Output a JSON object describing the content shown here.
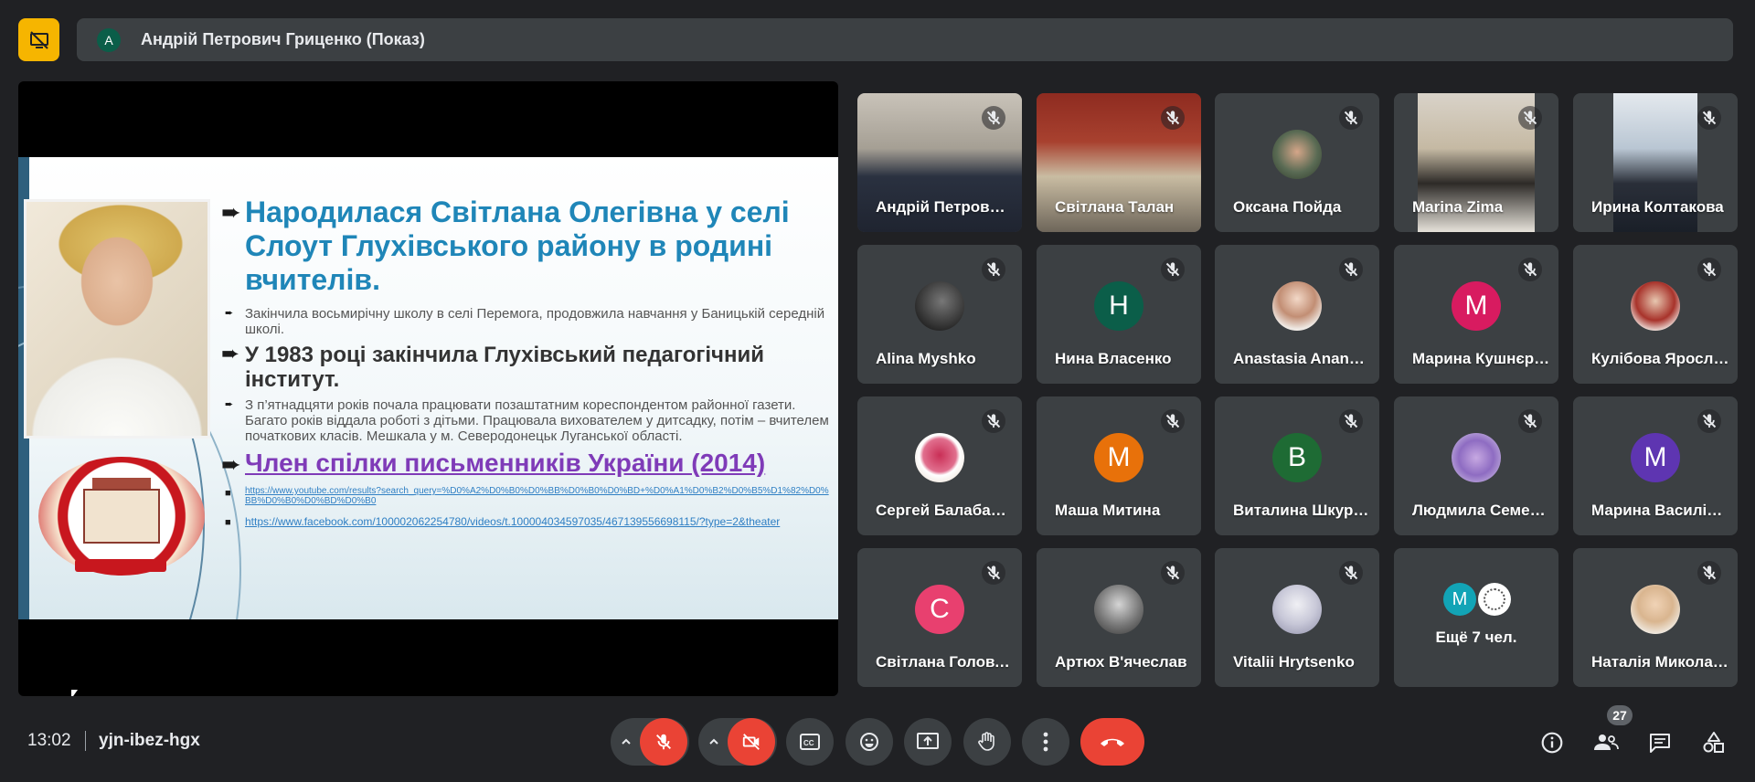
{
  "presenter_bar": {
    "avatar_letter": "A",
    "name": "Андрій Петрович Гриценко (Показ)"
  },
  "slide": {
    "heading": "Народилася Світлана Олегівна у селі Слоут Глухівського району в родині  вчителів.",
    "line1": "Закінчила восьмирічну школу в селі Перемога, продовжила навчання у Баницькій середній школі.",
    "line2": "У 1983 році закінчила Глухівський педагогічний інститут.",
    "line3": "З п’ятнадцяти років почала працювати позаштатним кореспондентом районної газети. Багато років віддала роботі з дітьми. Працювала вихователем у дитсадку, потім – вчителем початкових класів. Мешкала у м. Северодонецьк  Луганської області.",
    "line4": "Член спілки письменників України (2014)",
    "link1": "https://www.youtube.com/results?search_query=%D0%A2%D0%B0%D0%BB%D0%B0%D0%BD+%D0%A1%D0%B2%D0%B5%D1%82%D0%BB%D0%B0%D0%BD%D0%B0",
    "link2": "https://www.facebook.com/100002062254780/videos/t.100004034597035/467139556698115/?type=2&theater"
  },
  "participants": [
    {
      "name": "Андрій Петрович Гриценко",
      "type": "video"
    },
    {
      "name": "Світлана Талан",
      "type": "video"
    },
    {
      "name": "Оксана Пойда",
      "type": "photo"
    },
    {
      "name": "Marina Zima",
      "type": "video"
    },
    {
      "name": "Ирина Колтакова",
      "type": "video"
    },
    {
      "name": "Alina Myshko",
      "type": "photo"
    },
    {
      "name": "Нина Власенко",
      "type": "letter",
      "letter": "Н",
      "color": "#0b5e49"
    },
    {
      "name": "Anastasia Ananenko",
      "type": "photo"
    },
    {
      "name": "Марина Кушнєрова",
      "type": "letter",
      "letter": "М",
      "color": "#d81b60"
    },
    {
      "name": "Кулібова Ярослава",
      "type": "photo"
    },
    {
      "name": "Сергей Балабаненко",
      "type": "photo"
    },
    {
      "name": "Маша Митина",
      "type": "letter",
      "letter": "М",
      "color": "#e8710a"
    },
    {
      "name": "Виталина Шкурова",
      "type": "letter",
      "letter": "В",
      "color": "#1e6b34"
    },
    {
      "name": "Людмила Семенова",
      "type": "photo"
    },
    {
      "name": "Марина Василівна",
      "type": "letter",
      "letter": "М",
      "color": "#5e35b1"
    },
    {
      "name": "Світлана Головченко",
      "type": "letter",
      "letter": "С",
      "color": "#e8406f"
    },
    {
      "name": "Артюх В'ячеслав",
      "type": "photo"
    },
    {
      "name": "Vitalii Hrytsenko",
      "type": "photo"
    },
    {
      "name": "Ещё 7 чел.",
      "type": "more",
      "letter": "М"
    },
    {
      "name": "Наталія Миколаївна",
      "type": "photo"
    }
  ],
  "bottom_bar": {
    "time": "13:02",
    "meeting_code": "yjn-ibez-hgx",
    "people_count": "27"
  },
  "colors": {
    "background": "#202124",
    "tile": "#3c4043",
    "danger": "#ea4335",
    "present_toggle": "#f6b500"
  }
}
